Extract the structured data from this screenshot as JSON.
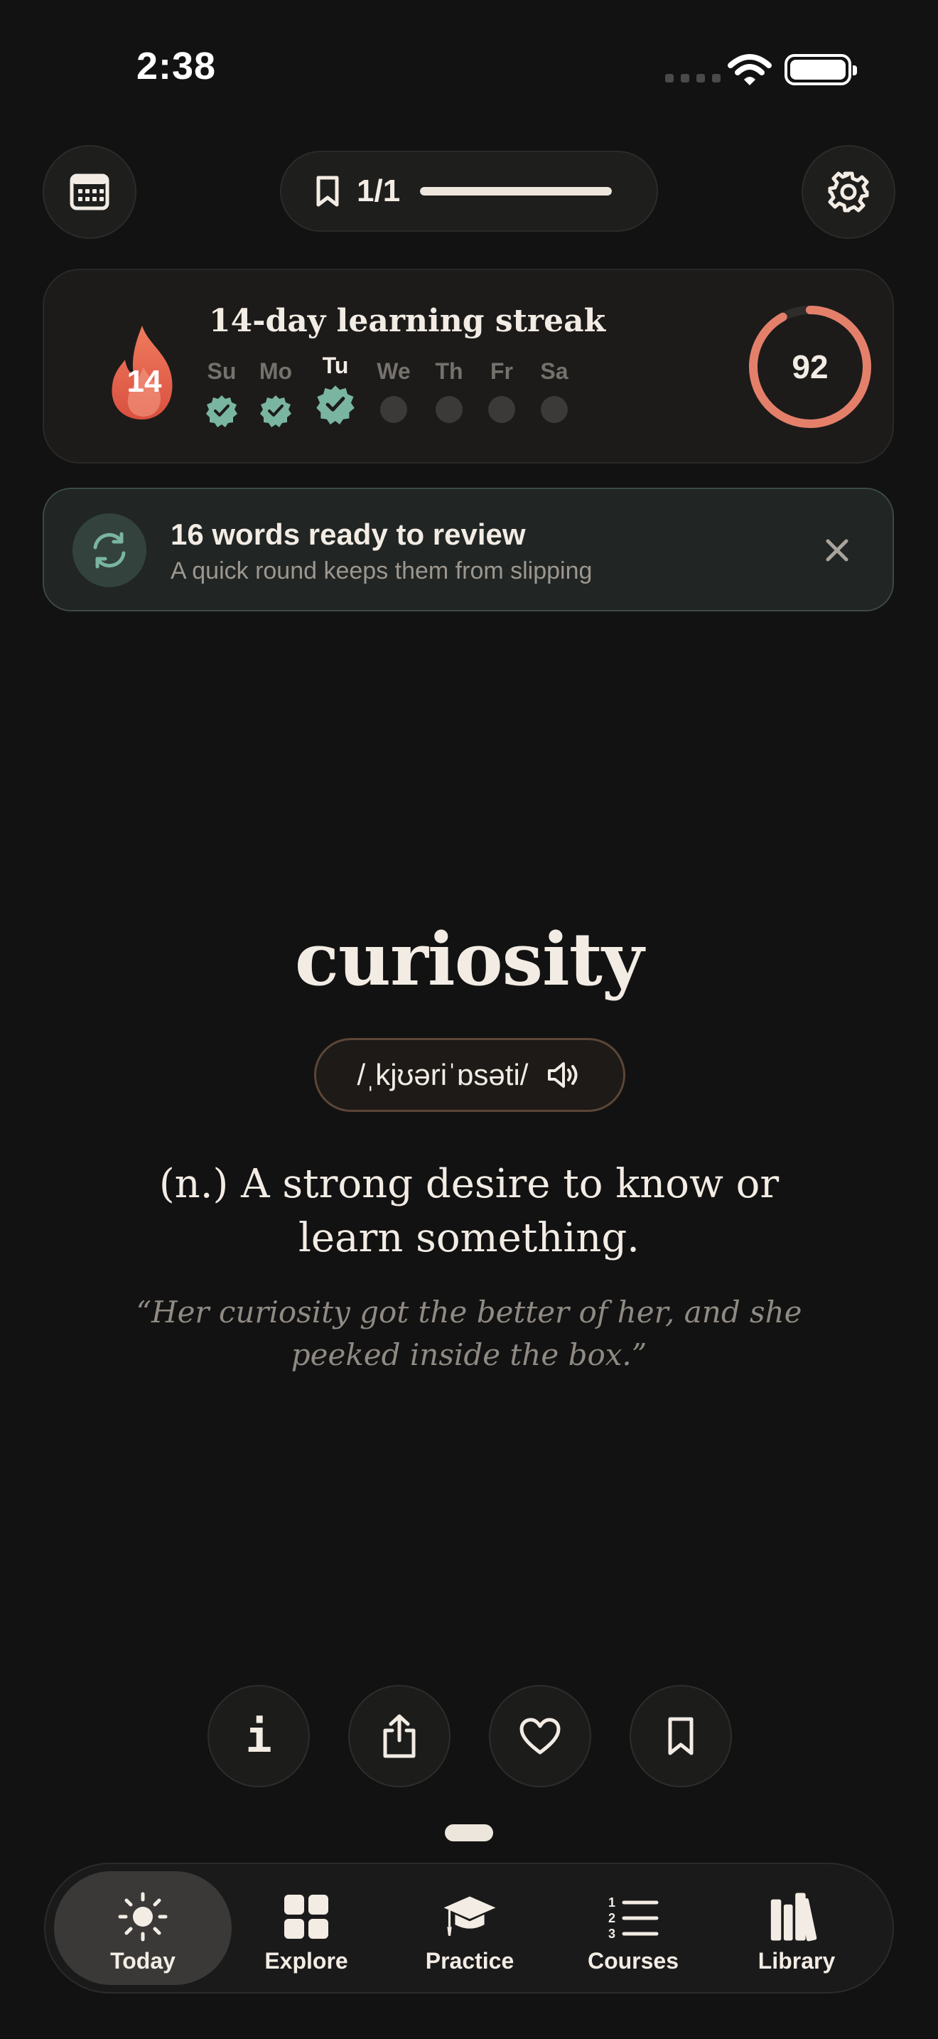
{
  "status_bar": {
    "time": "2:38"
  },
  "header": {
    "progress_label": "1/1",
    "progress_fraction": 1.0
  },
  "streak": {
    "count": "14",
    "title": "14-day learning streak",
    "score": "92",
    "score_fraction": 0.92,
    "days": [
      {
        "label": "Su",
        "done": true
      },
      {
        "label": "Mo",
        "done": true
      },
      {
        "label": "Tu",
        "done": true,
        "today": true
      },
      {
        "label": "We",
        "done": false
      },
      {
        "label": "Th",
        "done": false
      },
      {
        "label": "Fr",
        "done": false
      },
      {
        "label": "Sa",
        "done": false
      }
    ]
  },
  "review": {
    "title": "16 words ready to review",
    "subtitle": "A quick round keeps them from slipping"
  },
  "word": {
    "term": "curiosity",
    "phonetic": "/ˌkjʊəriˈɒsəti/",
    "definition": "(n.) A strong desire to know or learn something.",
    "example": "“Her curiosity got the better of her, and she peeked inside the box.”"
  },
  "actions": {
    "info_glyph": "i"
  },
  "tabs": [
    {
      "label": "Today",
      "icon": "sun-icon",
      "active": true
    },
    {
      "label": "Explore",
      "icon": "grid-icon"
    },
    {
      "label": "Practice",
      "icon": "graduation-cap-icon"
    },
    {
      "label": "Courses",
      "icon": "numbered-list-icon"
    },
    {
      "label": "Library",
      "icon": "books-icon"
    }
  ],
  "colors": {
    "background": "#131212",
    "accent_coral": "#e4806a",
    "accent_green": "#79b5a0",
    "text": "#f2ece4"
  }
}
